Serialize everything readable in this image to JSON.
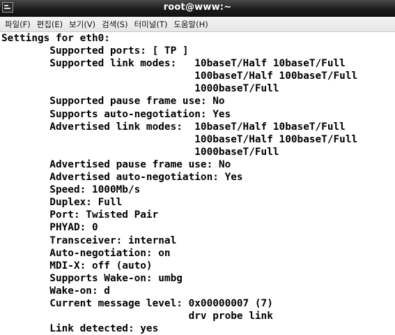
{
  "window": {
    "title": "root@www:~",
    "icon": "terminal-icon"
  },
  "menu": [
    {
      "id": "file",
      "label": "파일(F)"
    },
    {
      "id": "edit",
      "label": "편집(E)"
    },
    {
      "id": "view",
      "label": "보기(V)"
    },
    {
      "id": "search",
      "label": "검색(S)"
    },
    {
      "id": "terminal",
      "label": "터미널(T)"
    },
    {
      "id": "help",
      "label": "도움말(H)"
    }
  ],
  "terminal": {
    "lines": [
      "Settings for eth0:",
      "        Supported ports: [ TP ]",
      "        Supported link modes:   10baseT/Half 10baseT/Full",
      "                                100baseT/Half 100baseT/Full",
      "                                1000baseT/Full",
      "        Supported pause frame use: No",
      "        Supports auto-negotiation: Yes",
      "        Advertised link modes:  10baseT/Half 10baseT/Full",
      "                                100baseT/Half 100baseT/Full",
      "                                1000baseT/Full",
      "        Advertised pause frame use: No",
      "        Advertised auto-negotiation: Yes",
      "        Speed: 1000Mb/s",
      "        Duplex: Full",
      "        Port: Twisted Pair",
      "        PHYAD: 0",
      "        Transceiver: internal",
      "        Auto-negotiation: on",
      "        MDI-X: off (auto)",
      "        Supports Wake-on: umbg",
      "        Wake-on: d",
      "        Current message level: 0x00000007 (7)",
      "                               drv probe link",
      "        Link detected: yes"
    ]
  }
}
